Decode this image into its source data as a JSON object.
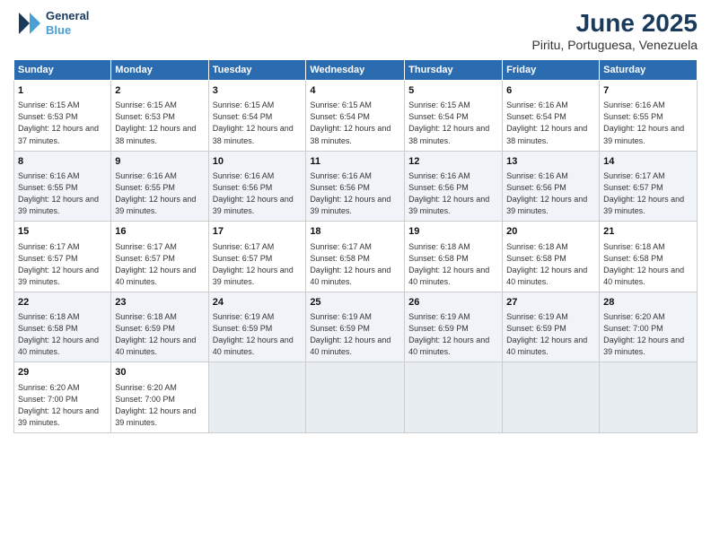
{
  "logo": {
    "line1": "General",
    "line2": "Blue"
  },
  "title": "June 2025",
  "subtitle": "Piritu, Portuguesa, Venezuela",
  "columns": [
    "Sunday",
    "Monday",
    "Tuesday",
    "Wednesday",
    "Thursday",
    "Friday",
    "Saturday"
  ],
  "weeks": [
    [
      {
        "day": "1",
        "sunrise": "6:15 AM",
        "sunset": "6:53 PM",
        "daylight": "12 hours and 37 minutes."
      },
      {
        "day": "2",
        "sunrise": "6:15 AM",
        "sunset": "6:53 PM",
        "daylight": "12 hours and 38 minutes."
      },
      {
        "day": "3",
        "sunrise": "6:15 AM",
        "sunset": "6:54 PM",
        "daylight": "12 hours and 38 minutes."
      },
      {
        "day": "4",
        "sunrise": "6:15 AM",
        "sunset": "6:54 PM",
        "daylight": "12 hours and 38 minutes."
      },
      {
        "day": "5",
        "sunrise": "6:15 AM",
        "sunset": "6:54 PM",
        "daylight": "12 hours and 38 minutes."
      },
      {
        "day": "6",
        "sunrise": "6:16 AM",
        "sunset": "6:54 PM",
        "daylight": "12 hours and 38 minutes."
      },
      {
        "day": "7",
        "sunrise": "6:16 AM",
        "sunset": "6:55 PM",
        "daylight": "12 hours and 39 minutes."
      }
    ],
    [
      {
        "day": "8",
        "sunrise": "6:16 AM",
        "sunset": "6:55 PM",
        "daylight": "12 hours and 39 minutes."
      },
      {
        "day": "9",
        "sunrise": "6:16 AM",
        "sunset": "6:55 PM",
        "daylight": "12 hours and 39 minutes."
      },
      {
        "day": "10",
        "sunrise": "6:16 AM",
        "sunset": "6:56 PM",
        "daylight": "12 hours and 39 minutes."
      },
      {
        "day": "11",
        "sunrise": "6:16 AM",
        "sunset": "6:56 PM",
        "daylight": "12 hours and 39 minutes."
      },
      {
        "day": "12",
        "sunrise": "6:16 AM",
        "sunset": "6:56 PM",
        "daylight": "12 hours and 39 minutes."
      },
      {
        "day": "13",
        "sunrise": "6:16 AM",
        "sunset": "6:56 PM",
        "daylight": "12 hours and 39 minutes."
      },
      {
        "day": "14",
        "sunrise": "6:17 AM",
        "sunset": "6:57 PM",
        "daylight": "12 hours and 39 minutes."
      }
    ],
    [
      {
        "day": "15",
        "sunrise": "6:17 AM",
        "sunset": "6:57 PM",
        "daylight": "12 hours and 39 minutes."
      },
      {
        "day": "16",
        "sunrise": "6:17 AM",
        "sunset": "6:57 PM",
        "daylight": "12 hours and 40 minutes."
      },
      {
        "day": "17",
        "sunrise": "6:17 AM",
        "sunset": "6:57 PM",
        "daylight": "12 hours and 39 minutes."
      },
      {
        "day": "18",
        "sunrise": "6:17 AM",
        "sunset": "6:58 PM",
        "daylight": "12 hours and 40 minutes."
      },
      {
        "day": "19",
        "sunrise": "6:18 AM",
        "sunset": "6:58 PM",
        "daylight": "12 hours and 40 minutes."
      },
      {
        "day": "20",
        "sunrise": "6:18 AM",
        "sunset": "6:58 PM",
        "daylight": "12 hours and 40 minutes."
      },
      {
        "day": "21",
        "sunrise": "6:18 AM",
        "sunset": "6:58 PM",
        "daylight": "12 hours and 40 minutes."
      }
    ],
    [
      {
        "day": "22",
        "sunrise": "6:18 AM",
        "sunset": "6:58 PM",
        "daylight": "12 hours and 40 minutes."
      },
      {
        "day": "23",
        "sunrise": "6:18 AM",
        "sunset": "6:59 PM",
        "daylight": "12 hours and 40 minutes."
      },
      {
        "day": "24",
        "sunrise": "6:19 AM",
        "sunset": "6:59 PM",
        "daylight": "12 hours and 40 minutes."
      },
      {
        "day": "25",
        "sunrise": "6:19 AM",
        "sunset": "6:59 PM",
        "daylight": "12 hours and 40 minutes."
      },
      {
        "day": "26",
        "sunrise": "6:19 AM",
        "sunset": "6:59 PM",
        "daylight": "12 hours and 40 minutes."
      },
      {
        "day": "27",
        "sunrise": "6:19 AM",
        "sunset": "6:59 PM",
        "daylight": "12 hours and 40 minutes."
      },
      {
        "day": "28",
        "sunrise": "6:20 AM",
        "sunset": "7:00 PM",
        "daylight": "12 hours and 39 minutes."
      }
    ],
    [
      {
        "day": "29",
        "sunrise": "6:20 AM",
        "sunset": "7:00 PM",
        "daylight": "12 hours and 39 minutes."
      },
      {
        "day": "30",
        "sunrise": "6:20 AM",
        "sunset": "7:00 PM",
        "daylight": "12 hours and 39 minutes."
      },
      null,
      null,
      null,
      null,
      null
    ]
  ],
  "labels": {
    "sunrise": "Sunrise:",
    "sunset": "Sunset:",
    "daylight": "Daylight:"
  }
}
